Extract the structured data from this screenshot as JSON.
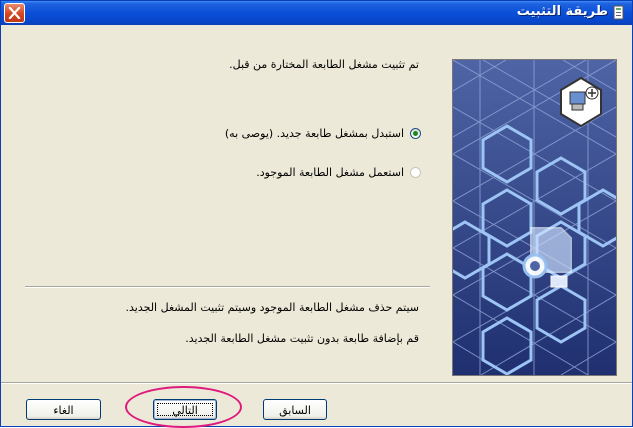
{
  "window": {
    "title": "طريقة التثبيت"
  },
  "main": {
    "intro": "تم تثبيت مشغل الطابعة المختارة من قبل.",
    "options": [
      {
        "label": "استبدل بمشغل طابعة جديد. (يوصى به)",
        "selected": true
      },
      {
        "label": "استعمل مشغل الطابعة الموجود.",
        "selected": false
      }
    ],
    "description_lines": [
      "سيتم حذف مشغل الطابعة الموجود وسيتم تثبيت المشغل الجديد.",
      "قم بإضافة طابعة بدون تثبيت مشغل الطابعة الجديد."
    ]
  },
  "buttons": {
    "back": "السابق",
    "next": "التالي",
    "cancel": "الغاء"
  },
  "colors": {
    "titlebar": "#0a4fd8",
    "panel": "#2b3f83",
    "highlight": "#e0197d"
  }
}
